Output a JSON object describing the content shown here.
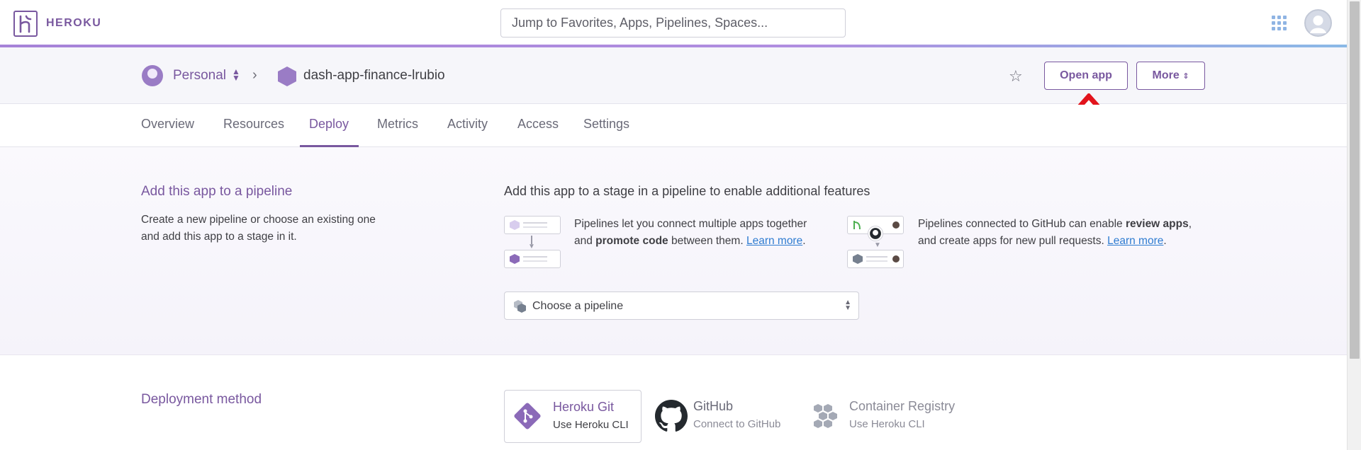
{
  "topnav": {
    "brand": "HEROKU",
    "search_placeholder": "Jump to Favorites, Apps, Pipelines, Spaces..."
  },
  "header": {
    "account": "Personal",
    "app_name": "dash-app-finance-lrubio",
    "open_app_label": "Open app",
    "more_label": "More"
  },
  "tabs": [
    {
      "label": "Overview"
    },
    {
      "label": "Resources"
    },
    {
      "label": "Deploy",
      "active": true
    },
    {
      "label": "Metrics"
    },
    {
      "label": "Activity"
    },
    {
      "label": "Access"
    },
    {
      "label": "Settings"
    }
  ],
  "pipeline": {
    "title": "Add this app to a pipeline",
    "description": "Create a new pipeline or choose an existing one and add this app to a stage in it.",
    "heading": "Add this app to a stage in a pipeline to enable additional features",
    "info1_pre": "Pipelines let you connect multiple apps together and ",
    "info1_bold": "promote code",
    "info1_post": " between them. ",
    "info1_link": "Learn more",
    "info2_pre": "Pipelines connected to GitHub can enable ",
    "info2_bold": "review apps",
    "info2_post": ", and create apps for new pull requests. ",
    "info2_link": "Learn more",
    "select_placeholder": "Choose a pipeline"
  },
  "deployment": {
    "title": "Deployment method",
    "methods": [
      {
        "title": "Heroku Git",
        "subtitle": "Use Heroku CLI"
      },
      {
        "title": "GitHub",
        "subtitle": "Connect to GitHub"
      },
      {
        "title": "Container Registry",
        "subtitle": "Use Heroku CLI"
      }
    ]
  },
  "colors": {
    "brand": "#79589f",
    "link": "#2f7cd1",
    "annotation_arrow": "#e2141c"
  }
}
